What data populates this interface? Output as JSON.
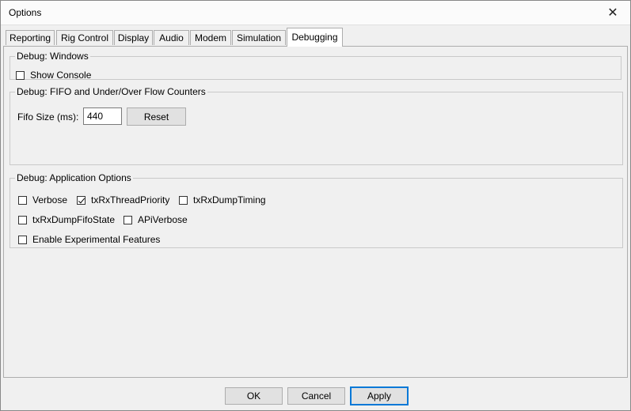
{
  "window": {
    "title": "Options"
  },
  "tabs": [
    {
      "label": "Reporting"
    },
    {
      "label": "Rig Control"
    },
    {
      "label": "Display"
    },
    {
      "label": "Audio"
    },
    {
      "label": "Modem"
    },
    {
      "label": "Simulation"
    },
    {
      "label": "Debugging",
      "active": true
    }
  ],
  "debug_windows": {
    "legend": "Debug: Windows",
    "show_console": {
      "label": "Show Console",
      "checked": false
    }
  },
  "fifo": {
    "legend": "Debug: FIFO and Under/Over Flow Counters",
    "fifo_size_label": "Fifo Size (ms):",
    "fifo_size_value": "440",
    "reset_label": "Reset"
  },
  "app_options": {
    "legend": "Debug: Application Options",
    "verbose": {
      "label": "Verbose",
      "checked": false
    },
    "tx_rx_thread_priority": {
      "label": "txRxThreadPriority",
      "checked": true
    },
    "tx_rx_dump_timing": {
      "label": "txRxDumpTiming",
      "checked": false
    },
    "tx_rx_dump_fifo_state": {
      "label": "txRxDumpFifoState",
      "checked": false
    },
    "api_verbose": {
      "label": "APiVerbose",
      "checked": false
    },
    "experimental": {
      "label": "Enable Experimental Features",
      "checked": false
    }
  },
  "footer": {
    "ok_label": "OK",
    "cancel_label": "Cancel",
    "apply_label": "Apply"
  }
}
